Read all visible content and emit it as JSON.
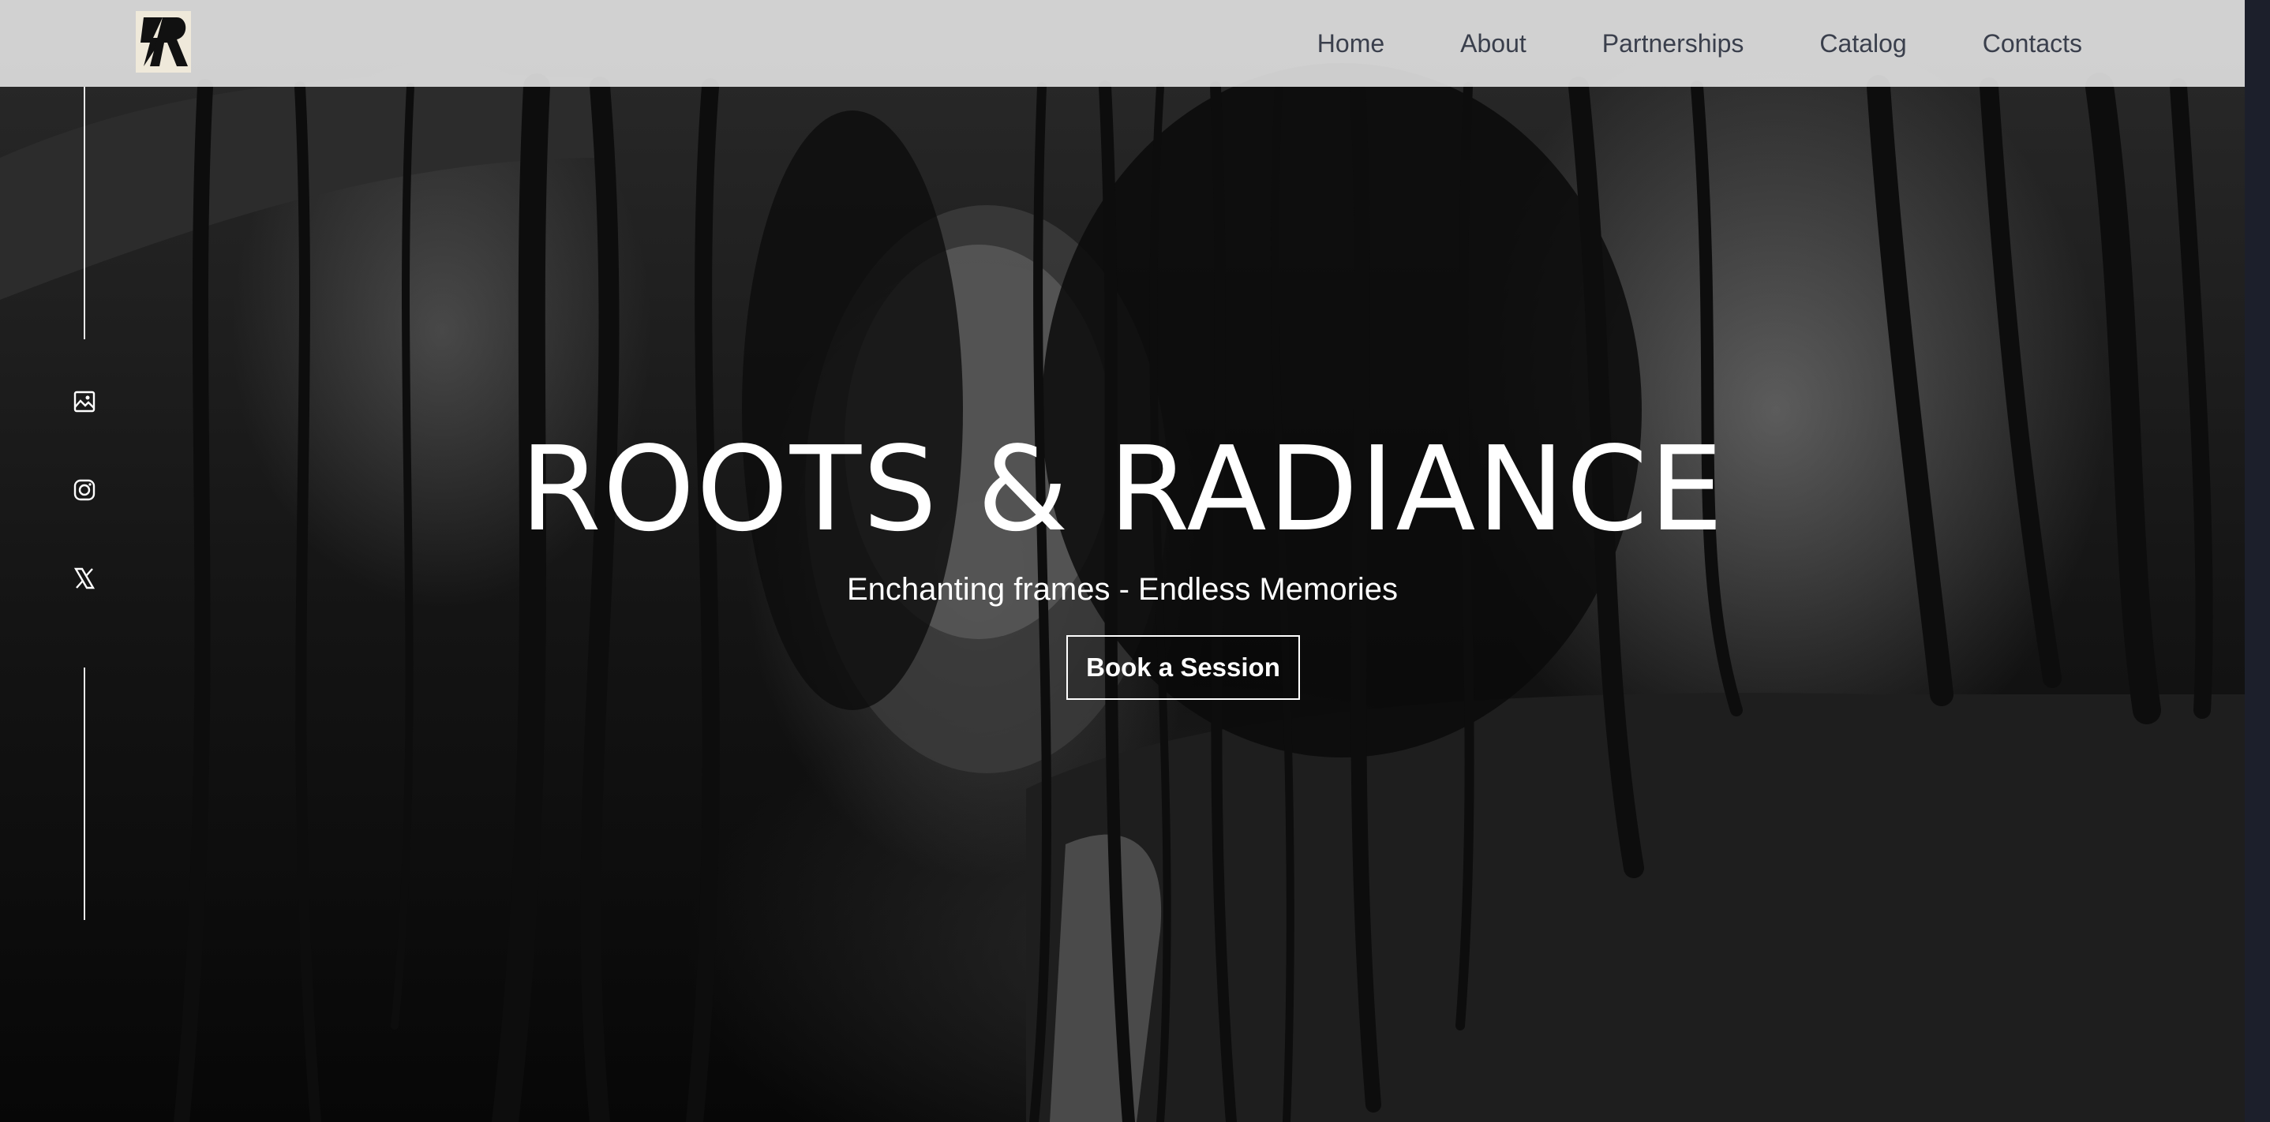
{
  "header": {
    "logo_alt": "Roots & Radiance logo",
    "nav": [
      {
        "label": "Home"
      },
      {
        "label": "About"
      },
      {
        "label": "Partnerships"
      },
      {
        "label": "Catalog"
      },
      {
        "label": "Contacts"
      }
    ]
  },
  "social": {
    "icons": [
      "gallery-icon",
      "instagram-icon",
      "x-icon"
    ]
  },
  "hero": {
    "title": "ROOTS & RADIANCE",
    "subtitle": "Enchanting frames - Endless Memories",
    "cta_label": "Book a Session"
  },
  "colors": {
    "header_bg": "#e8e8e8",
    "nav_text": "#3a3f4c",
    "hero_text": "#ffffff",
    "right_strip": "#1c1f2b"
  }
}
